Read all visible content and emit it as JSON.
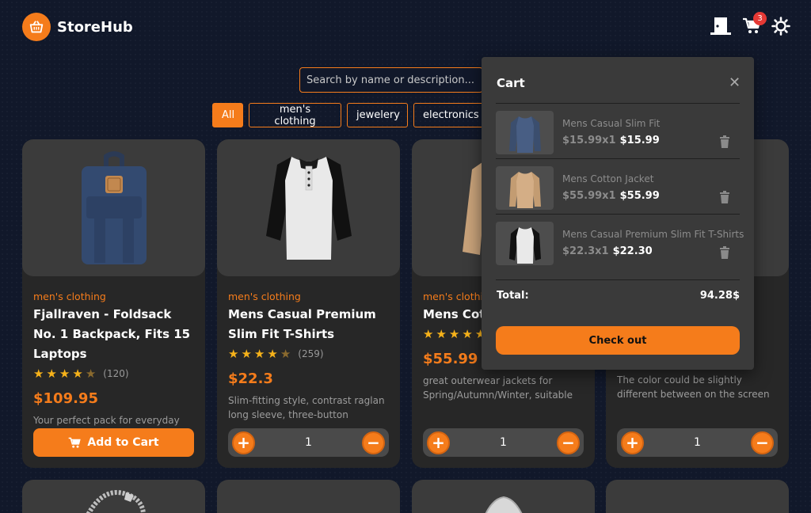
{
  "header": {
    "brand": "StoreHub",
    "logo_icon": "basket-icon",
    "logout_icon": "door-icon",
    "cart_icon": "cart-icon",
    "cart_count": "3",
    "theme_icon": "sun-icon",
    "accent": "#f57c1b"
  },
  "search": {
    "placeholder": "Search by name or description..."
  },
  "categories": [
    {
      "label": "All",
      "active": true
    },
    {
      "label": "men's clothing",
      "active": false
    },
    {
      "label": "jewelery",
      "active": false
    },
    {
      "label": "electronics",
      "active": false
    }
  ],
  "products": [
    {
      "category": "men's clothing",
      "title": "Fjallraven - Foldsack No. 1 Backpack, Fits 15 Laptops",
      "rating": 4,
      "rating_count": "(120)",
      "price": "$109.95",
      "description": "Your perfect pack for everyday use and walks in the forest. Stash your...",
      "action": "add",
      "add_label": "Add to Cart"
    },
    {
      "category": "men's clothing",
      "title": "Mens Casual Premium Slim Fit T-Shirts",
      "rating": 4,
      "rating_count": "(259)",
      "price": "$22.3",
      "description": "Slim-fitting style, contrast raglan long sleeve, three-button henley...",
      "action": "stepper",
      "quantity": "1"
    },
    {
      "category": "men's clothing",
      "title": "Mens Cotton Jacket",
      "rating": 5,
      "rating_count": "",
      "price": "$55.99",
      "description": "great outerwear jackets for Spring/Autumn/Winter, suitable for many...",
      "action": "stepper",
      "quantity": "1"
    },
    {
      "category": "",
      "title": "",
      "rating": 0,
      "rating_count": "",
      "price": "",
      "description": "The color could be slightly different between on the screen and in...",
      "action": "stepper",
      "quantity": "1"
    }
  ],
  "cart": {
    "title": "Cart",
    "close_icon": "close-icon",
    "items": [
      {
        "name": "Mens Casual Slim Fit",
        "unit": "$15.99x1",
        "total": "$15.99"
      },
      {
        "name": "Mens Cotton Jacket",
        "unit": "$55.99x1",
        "total": "$55.99"
      },
      {
        "name": "Mens Casual Premium Slim Fit T-Shirts",
        "unit": "$22.3x1",
        "total": "$22.30"
      }
    ],
    "total_label": "Total:",
    "total_value": "94.28$",
    "checkout_label": "Check out",
    "trash_icon": "trash-icon"
  }
}
